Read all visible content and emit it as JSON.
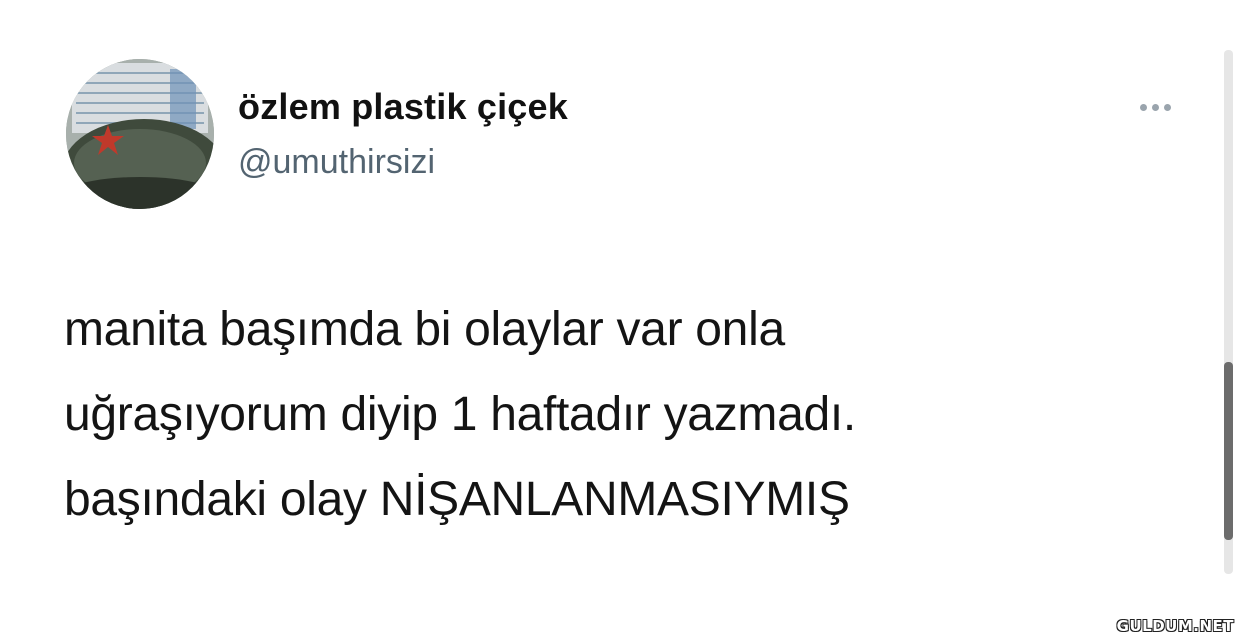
{
  "tweet": {
    "display_name": "özlem plastik çiçek",
    "handle": "@umuthirsizi",
    "text_lines": [
      "manita başımda bi olaylar var onla",
      "uğraşıyorum diyip 1 haftadır yazmadı.",
      "başındaki olay NİŞANLANMASIYMIŞ"
    ]
  },
  "icons": {
    "avatar": "profile-photo",
    "more": "more-options-icon"
  },
  "colors": {
    "text": "#141414",
    "handle": "#536471",
    "avatar_star": "#c0392b"
  },
  "watermark": "GULDUM.NET"
}
